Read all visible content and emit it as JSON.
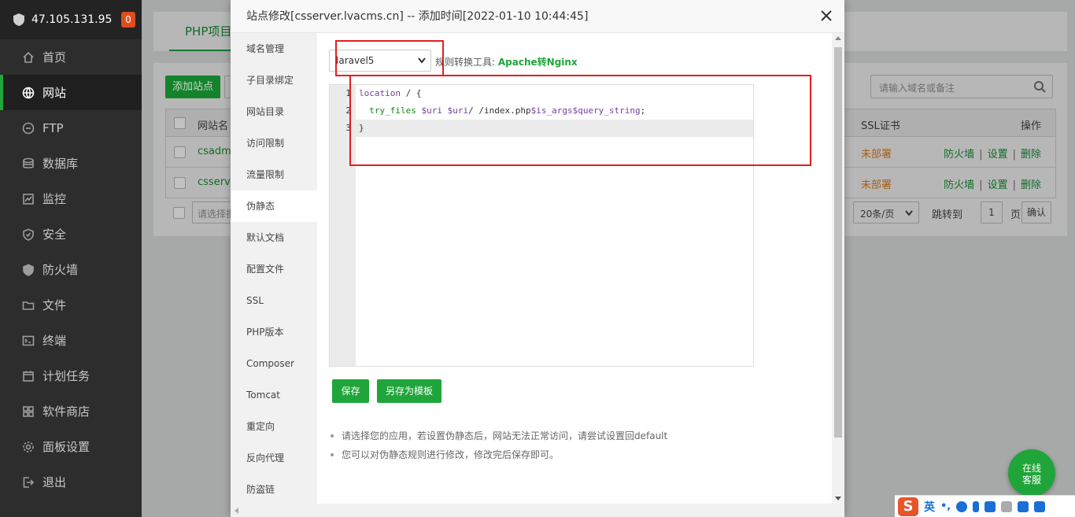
{
  "sidebar": {
    "server_ip": "47.105.131.95",
    "badge": "0",
    "items": [
      {
        "label": "首页",
        "icon": "home-icon"
      },
      {
        "label": "网站",
        "icon": "globe-icon",
        "active": true
      },
      {
        "label": "FTP",
        "icon": "ftp-icon"
      },
      {
        "label": "数据库",
        "icon": "database-icon"
      },
      {
        "label": "监控",
        "icon": "monitor-icon"
      },
      {
        "label": "安全",
        "icon": "shield-icon"
      },
      {
        "label": "防火墙",
        "icon": "firewall-icon"
      },
      {
        "label": "文件",
        "icon": "folder-icon"
      },
      {
        "label": "终端",
        "icon": "terminal-icon"
      },
      {
        "label": "计划任务",
        "icon": "calendar-icon"
      },
      {
        "label": "软件商店",
        "icon": "store-icon"
      },
      {
        "label": "面板设置",
        "icon": "gear-icon"
      },
      {
        "label": "退出",
        "icon": "logout-icon"
      }
    ]
  },
  "main": {
    "tab_label": "PHP项目",
    "add_site_label": "添加站点",
    "search_placeholder": "请输入域名或备注",
    "columns": {
      "name": "网站名",
      "ssl": "SSL证书",
      "ops": "操作"
    },
    "rows": [
      {
        "name": "csadmi",
        "ssl": "未部署"
      },
      {
        "name": "csserver",
        "ssl": "未部署"
      }
    ],
    "ops": {
      "firewall": "防火墙",
      "settings": "设置",
      "delete": "删除"
    },
    "batch_placeholder": "请选择批",
    "page_size": "20条/页",
    "jump_label": "跳转到",
    "page_number": "1",
    "page_unit": "页",
    "confirm_label": "确认"
  },
  "modal": {
    "title": "站点修改[csserver.lvacms.cn] -- 添加时间[2022-01-10 10:44:45]",
    "menu": [
      "域名管理",
      "子目录绑定",
      "网站目录",
      "访问限制",
      "流量限制",
      "伪静态",
      "默认文档",
      "配置文件",
      "SSL",
      "PHP版本",
      "Composer",
      "Tomcat",
      "重定向",
      "反向代理",
      "防盗链"
    ],
    "active_menu": "伪静态",
    "template_select": "laravel5",
    "tool_label": "规则转换工具:",
    "tool_link": "Apache转Nginx",
    "line_numbers": [
      "1",
      "2",
      "3"
    ],
    "code": {
      "line1_kw": "location",
      "line1_rest": " / {",
      "line2_fn": "try_files",
      "line2_var1": "$uri",
      "line2_var2": "$uri",
      "line2_mid": "/ /index.php",
      "line2_var3": "$is_args$query_string",
      "line2_end": ";",
      "line3": "}"
    },
    "save_label": "保存",
    "save_template_label": "另存为模板",
    "tips": [
      "请选择您的应用，若设置伪静态后，网站无法正常访问，请尝试设置回default",
      "您可以对伪静态规则进行修改，修改完后保存即可。"
    ]
  },
  "service_button": {
    "line1": "在线",
    "line2": "客服"
  },
  "ime": {
    "lang": "英"
  },
  "colors": {
    "accent": "#20a53a",
    "highlight_box": "#e02020",
    "sidebar_bg": "#2d2d2d"
  }
}
